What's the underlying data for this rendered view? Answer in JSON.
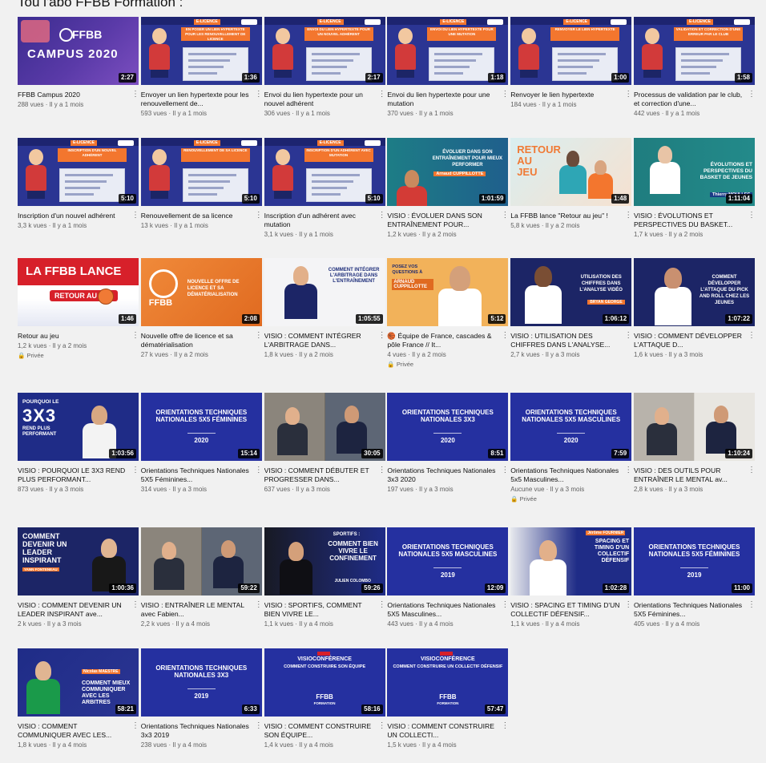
{
  "header": {
    "title": "Tou l'abo FFBB Formation :"
  },
  "videos": [
    {
      "title": "FFBB Campus 2020",
      "views": "288 vues · Il y a 1 mois",
      "duration": "2:27",
      "thumb": "campus",
      "thumb_text": [
        "FFBB",
        "CAMPUS 2020"
      ]
    },
    {
      "title": "Envoyer un lien hypertexte pour les renouvellement de...",
      "views": "593 vues · Il y a 1 mois",
      "duration": "1:36",
      "thumb": "eli",
      "thumb_text": [
        "E-LICENCE",
        "EN POSER UN LIEN HYPERTEXTE POUR LES RENOUVELLEMENT DE LICENCE"
      ]
    },
    {
      "title": "Envoi du lien hypertexte pour un nouvel adhérent",
      "views": "306 vues · Il y a 1 mois",
      "duration": "2:17",
      "thumb": "eli",
      "thumb_text": [
        "E-LICENCE",
        "ENVOI DU LIEN HYPERTEXTE POUR UN NOUVEL ADHÉRENT"
      ]
    },
    {
      "title": "Envoi du lien hypertexte pour une mutation",
      "views": "370 vues · Il y a 1 mois",
      "duration": "1:18",
      "thumb": "eli",
      "thumb_text": [
        "E-LICENCE",
        "ENVOI DU LIEN HYPERTEXTE POUR UNE MUTATION"
      ]
    },
    {
      "title": "Renvoyer le lien hypertexte",
      "views": "184 vues · Il y a 1 mois",
      "duration": "1:00",
      "thumb": "eli",
      "thumb_text": [
        "E-LICENCE",
        "RENVOYER LE LIEN HYPERTEXTE"
      ]
    },
    {
      "title": "Processus de validation par le club, et correction d'une...",
      "views": "442 vues · Il y a 1 mois",
      "duration": "1:58",
      "thumb": "eli",
      "thumb_text": [
        "E-LICENCE",
        "VALIDATION ET CORRECTION D'UNE ERREUR PAR LE CLUB"
      ]
    },
    {
      "title": "Inscription d'un nouvel adhérent",
      "views": "3,3 k vues · Il y a 1 mois",
      "duration": "5:10",
      "thumb": "eli",
      "thumb_text": [
        "E-LICENCE",
        "INSCRIPTION D'UN NOUVEL ADHÉRENT"
      ]
    },
    {
      "title": "Renouvellement de sa licence",
      "views": "13 k vues · Il y a 1 mois",
      "duration": "5:10",
      "thumb": "eli",
      "thumb_text": [
        "E-LICENCE",
        "RENOUVELLEMENT DE SA LICENCE"
      ]
    },
    {
      "title": "Inscription d'un adhérent avec mutation",
      "views": "3,1 k vues · Il y a 1 mois",
      "duration": "5:10",
      "thumb": "eli",
      "thumb_text": [
        "E-LICENCE",
        "INSCRIPTION D'UN ADHÉRENT AVEC MUTATION"
      ]
    },
    {
      "title": "VISIO : ÉVOLUER DANS SON ENTRAÎNEMENT POUR...",
      "views": "1,2 k vues · Il y a 2 mois",
      "duration": "1:01:59",
      "thumb": "visio",
      "thumb_text": [
        "ÉVOLUER DANS SON ENTRAÎNEMENT POUR MIEUX PERFORMER",
        "Arnaud CUPPILLOTTE"
      ]
    },
    {
      "title": "La FFBB lance \"Retour au jeu\" !",
      "views": "5,8 k vues · Il y a 2 mois",
      "duration": "1:48",
      "thumb": "retour",
      "thumb_text": [
        "RETOUR AU JEU"
      ]
    },
    {
      "title": "VISIO : ÉVOLUTIONS ET PERSPECTIVES DU BASKET...",
      "views": "1,7 k vues · Il y a 2 mois",
      "duration": "1:11:04",
      "thumb": "visio2",
      "thumb_text": [
        "ÉVOLUTIONS ET PERSPECTIVES DU BASKET DE JEUNES",
        "Thierry MOULLEC"
      ]
    },
    {
      "title": "Retour au jeu",
      "views": "1,2 k vues · Il y a 2 mois",
      "duration": "1:46",
      "thumb": "lance",
      "private": "Privée",
      "thumb_text": [
        "LA FFBB LANCE",
        "RETOUR AU JEU"
      ]
    },
    {
      "title": "Nouvelle offre de licence et sa dématérialisation",
      "views": "27 k vues · Il y a 2 mois",
      "duration": "2:08",
      "thumb": "orange",
      "thumb_text": [
        "FFBB",
        "NOUVELLE OFFRE DE LICENCE ET SA DÉMATÉRIALISATION"
      ]
    },
    {
      "title": "VISIO : COMMENT INTÉGRER L'ARBITRAGE DANS...",
      "views": "1,8 k vues · Il y a 2 mois",
      "duration": "1:05:55",
      "thumb": "white",
      "thumb_text": [
        "COMMENT INTÉGRER L'ARBITRAGE DANS L'ENTRAÎNEMENT"
      ]
    },
    {
      "title": "🏀 Équipe de France, cascades & pôle France // It...",
      "views": "4 vues · Il y a 2 mois",
      "duration": "5:12",
      "thumb": "face",
      "private": "Privée",
      "thumb_text": [
        "POSEZ VOS QUESTIONS À",
        "ARNAUD CUPPILLOTTE"
      ]
    },
    {
      "title": "VISIO : UTILISATION DES CHIFFRES DANS L'ANALYSE...",
      "views": "2,7 k vues · Il y a 3 mois",
      "duration": "1:06:12",
      "thumb": "navy",
      "thumb_text": [
        "UTILISATION DES CHIFFRES DANS L'ANALYSE VIDÉO",
        "BRYAN GEORGE"
      ]
    },
    {
      "title": "VISIO : COMMENT DÉVELOPPER L'ATTAQUE D...",
      "views": "1,6 k vues · Il y a 3 mois",
      "duration": "1:07:22",
      "thumb": "navy2",
      "thumb_text": [
        "COMMENT DÉVELOPPER L'ATTAQUE DU PICK AND ROLL CHEZ LES JEUNES",
        "FRANCE"
      ]
    },
    {
      "title": "VISIO : POURQUOI LE 3X3 REND PLUS PERFORMANT...",
      "views": "873 vues · Il y a 3 mois",
      "duration": "1:03:56",
      "thumb": "3x3",
      "thumb_text": [
        "POURQUOI LE",
        "3X3",
        "REND PLUS PERFORMANT"
      ]
    },
    {
      "title": "Orientations Techniques Nationales 5X5 Féminines...",
      "views": "314 vues · Il y a 3 mois",
      "duration": "15:14",
      "thumb": "orient",
      "thumb_text": [
        "ORIENTATIONS TECHNIQUES NATIONALES 5X5 FÉMININES",
        "2020"
      ]
    },
    {
      "title": "VISIO : COMMENT DÉBUTER ET PROGRESSER DANS...",
      "views": "637 vues · Il y a 3 mois",
      "duration": "30:05",
      "thumb": "duo",
      "thumb_text": []
    },
    {
      "title": "Orientations Techniques Nationales 3x3 2020",
      "views": "197 vues · Il y a 3 mois",
      "duration": "8:51",
      "thumb": "orient",
      "thumb_text": [
        "ORIENTATIONS TECHNIQUES NATIONALES 3X3",
        "2020"
      ]
    },
    {
      "title": "Orientations Techniques Nationales 5x5 Masculines...",
      "views": "Aucune vue · Il y a 3 mois",
      "duration": "7:59",
      "thumb": "orient",
      "private": "Privée",
      "thumb_text": [
        "ORIENTATIONS TECHNIQUES NATIONALES 5X5 MASCULINES",
        "2020"
      ]
    },
    {
      "title": "VISIO : DES OUTILS POUR ENTRAÎNER LE MENTAL av...",
      "views": "2,8 k vues · Il y a 3 mois",
      "duration": "1:10:24",
      "thumb": "duo2",
      "thumb_text": []
    },
    {
      "title": "VISIO : COMMENT DEVENIR UN LEADER INSPIRANT ave...",
      "views": "2 k vues · Il y a 3 mois",
      "duration": "1:00:36",
      "thumb": "leader",
      "thumb_text": [
        "COMMENT DEVENIR UN LEADER INSPIRANT",
        "YANN FONTENEAU"
      ]
    },
    {
      "title": "VISIO : ENTRAÎNER LE MENTAL avec Fabien...",
      "views": "2,2 k vues · Il y a 4 mois",
      "duration": "59:22",
      "thumb": "duo",
      "thumb_text": []
    },
    {
      "title": "VISIO : SPORTIFS, COMMENT BIEN VIVRE LE...",
      "views": "1,1 k vues · Il y a 4 mois",
      "duration": "59:26",
      "thumb": "confine",
      "thumb_text": [
        "SPORTIFS :",
        "COMMENT BIEN VIVRE LE CONFINEMENT",
        "JULIEN COLOMBO"
      ]
    },
    {
      "title": "Orientations Techniques Nationales 5X5 Masculines...",
      "views": "443 vues · Il y a 4 mois",
      "duration": "12:09",
      "thumb": "orient",
      "thumb_text": [
        "ORIENTATIONS TECHNIQUES NATIONALES 5X5 MASCULINES",
        "2019"
      ]
    },
    {
      "title": "VISIO : SPACING ET TIMING D'UN COLLECTIF DÉFENSIF...",
      "views": "1,1 k vues · Il y a 4 mois",
      "duration": "1:02:28",
      "thumb": "spacing",
      "thumb_text": [
        "Jérôme FOURNIER",
        "SPACING ET TIMING D'UN COLLECTIF DÉFENSIF"
      ]
    },
    {
      "title": "Orientations Techniques Nationales 5X5 Féminines...",
      "views": "405 vues · Il y a 4 mois",
      "duration": "11:00",
      "thumb": "orient",
      "thumb_text": [
        "ORIENTATIONS TECHNIQUES NATIONALES 5X5 FÉMININES",
        "2019"
      ]
    },
    {
      "title": "VISIO : COMMENT COMMUNIQUER AVEC LES...",
      "views": "1,8 k vues · Il y a 4 mois",
      "duration": "58:21",
      "thumb": "commun",
      "thumb_text": [
        "Nicolas MAESTRE",
        "COMMENT MIEUX COMMUNIQUER AVEC LES ARBITRES"
      ]
    },
    {
      "title": "Orientations Techniques Nationales 3x3 2019",
      "views": "238 vues · Il y a 4 mois",
      "duration": "6:33",
      "thumb": "orient",
      "thumb_text": [
        "ORIENTATIONS TECHNIQUES NATIONALES 3X3",
        "2019"
      ]
    },
    {
      "title": "VISIO : COMMENT CONSTRUIRE SON ÉQUIPE...",
      "views": "1,4 k vues · Il y a 4 mois",
      "duration": "58:16",
      "thumb": "visioconf",
      "thumb_text": [
        "VISIOCONFÉRENCE",
        "COMMENT CONSTRUIRE SON ÉQUIPE",
        "FFBB",
        "FORMATION"
      ]
    },
    {
      "title": "VISIO : COMMENT CONSTRUIRE UN COLLECTI...",
      "views": "1,5 k vues · Il y a 4 mois",
      "duration": "57:47",
      "thumb": "visioconf",
      "thumb_text": [
        "VISIOCONFÉRENCE",
        "COMMENT CONSTRUIRE UN COLLECTIF DÉFENSIF",
        "FFBB",
        "FORMATION"
      ]
    }
  ],
  "colors": {
    "ffbb_blue": "#2530a0",
    "elicence_orange": "#f3762e",
    "bg": "#f1f1f1",
    "meta_grey": "#606060"
  }
}
